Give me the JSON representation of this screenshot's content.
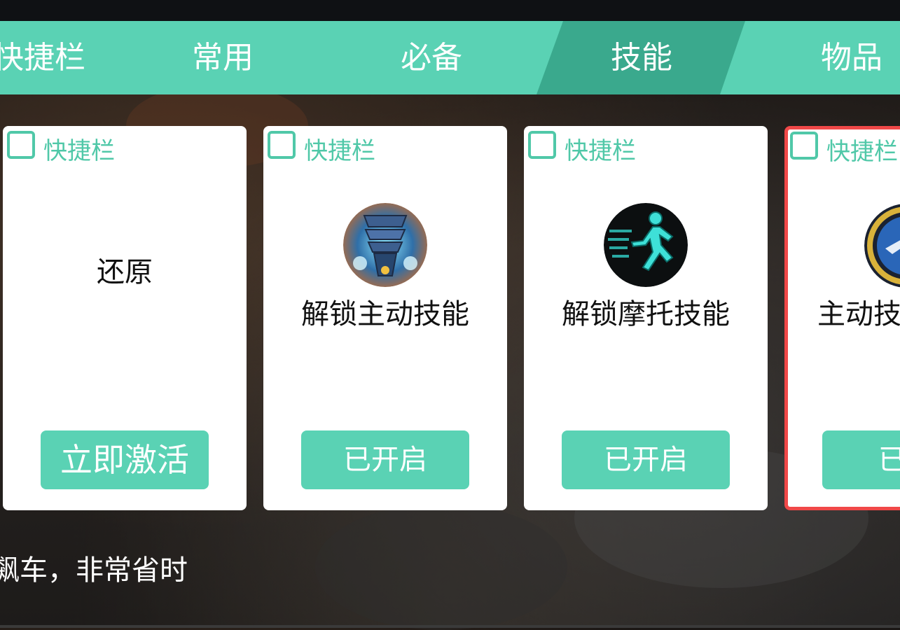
{
  "tabs": [
    {
      "label": "快捷栏",
      "active": false
    },
    {
      "label": "常用",
      "active": false
    },
    {
      "label": "必备",
      "active": false
    },
    {
      "label": "技能",
      "active": true
    },
    {
      "label": "物品",
      "active": false
    }
  ],
  "cards": [
    {
      "checkbox_label": "快捷栏",
      "checked": false,
      "title": "还原",
      "icon": "none",
      "button_label": "立即激活"
    },
    {
      "checkbox_label": "快捷栏",
      "checked": false,
      "title": "解锁主动技能",
      "icon": "armored-warrior-icon",
      "button_label": "已开启"
    },
    {
      "checkbox_label": "快捷栏",
      "checked": false,
      "title": "解锁摩托技能",
      "icon": "running-man-icon",
      "button_label": "已开启"
    },
    {
      "checkbox_label": "快捷栏",
      "checked": false,
      "title": "主动技",
      "icon": "sword-shield-icon",
      "button_label": "已开",
      "selected": true
    }
  ],
  "footer": {
    "text": "飙车，非常省时"
  },
  "colors": {
    "accent": "#5ad2b4",
    "accent_dark": "#3aa98d",
    "selected_border": "#f04848"
  }
}
